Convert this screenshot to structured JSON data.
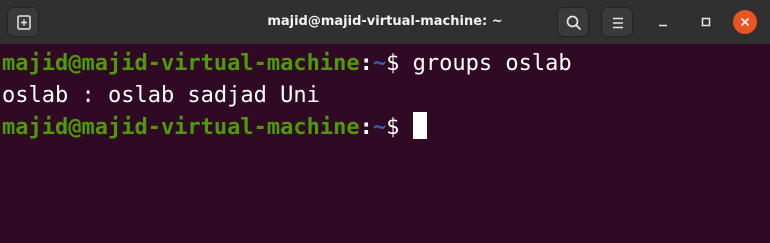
{
  "window": {
    "title": "majid@majid-virtual-machine: ~"
  },
  "prompt": {
    "userhost": "majid@majid-virtual-machine",
    "colon": ":",
    "path": "~",
    "symbol": "$ "
  },
  "lines": [
    {
      "command": "groups oslab"
    },
    {
      "output": "oslab : oslab sadjad Uni"
    },
    {
      "command": ""
    }
  ],
  "icons": {
    "new_tab": "new-tab-icon",
    "search": "search-icon",
    "menu": "hamburger-menu-icon",
    "minimize": "minimize-icon",
    "maximize": "maximize-icon",
    "close": "close-icon"
  },
  "colors": {
    "terminal_background": "#300a24",
    "titlebar_background": "#303030",
    "prompt_userhost": "#4e9a06",
    "prompt_path": "#3465a4",
    "close_button": "#e95420"
  }
}
